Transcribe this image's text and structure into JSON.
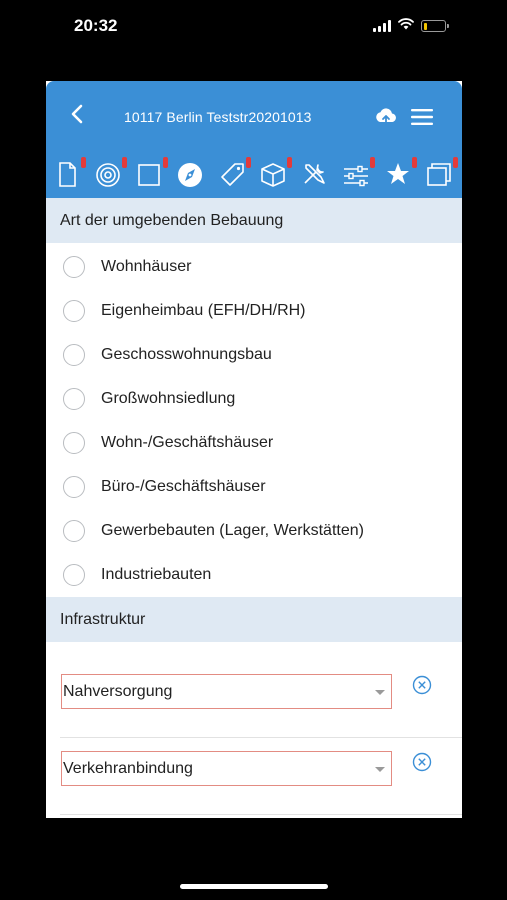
{
  "status_bar": {
    "time": "20:32",
    "battery_level": 0.15,
    "icons": [
      "signal-icon",
      "wifi-icon",
      "battery-icon"
    ]
  },
  "header": {
    "title": "10117 Berlin Teststr20201013",
    "back_icon": "chevron-left-icon",
    "cloud_icon": "cloud-upload-icon",
    "menu_icon": "hamburger-menu-icon"
  },
  "toolbar": {
    "tools": [
      {
        "icon": "document-icon",
        "flag": true
      },
      {
        "icon": "target-icon",
        "flag": true
      },
      {
        "icon": "square-icon",
        "flag": true
      },
      {
        "icon": "compass-icon",
        "flag": false,
        "active": true
      },
      {
        "icon": "tag-icon",
        "flag": true
      },
      {
        "icon": "cube-icon",
        "flag": true
      },
      {
        "icon": "tools-icon",
        "flag": false
      },
      {
        "icon": "sliders-icon",
        "flag": true
      },
      {
        "icon": "star-icon",
        "flag": true
      },
      {
        "icon": "layers-icon",
        "flag": true
      }
    ],
    "flag_color": "#e23b3b"
  },
  "section_bebauung": {
    "title": "Art der umgebenden Bebauung",
    "options": [
      "Wohnhäuser",
      "Eigenheimbau (EFH/DH/RH)",
      "Geschosswohnungsbau",
      "Großwohnsiedlung",
      "Wohn-/Geschäftshäuser",
      "Büro-/Geschäftshäuser",
      "Gewerbebauten (Lager, Werkstätten)",
      "Industriebauten"
    ]
  },
  "section_infrastruktur": {
    "title": "Infrastruktur",
    "selects": [
      {
        "value": "Nahversorgung"
      },
      {
        "value": "Verkehranbindung"
      }
    ]
  },
  "colors": {
    "header_blue": "#3b8fd6",
    "section_bg": "#dfe9f3",
    "error_border": "#e38c83",
    "clear_icon": "#3b8fd6"
  }
}
